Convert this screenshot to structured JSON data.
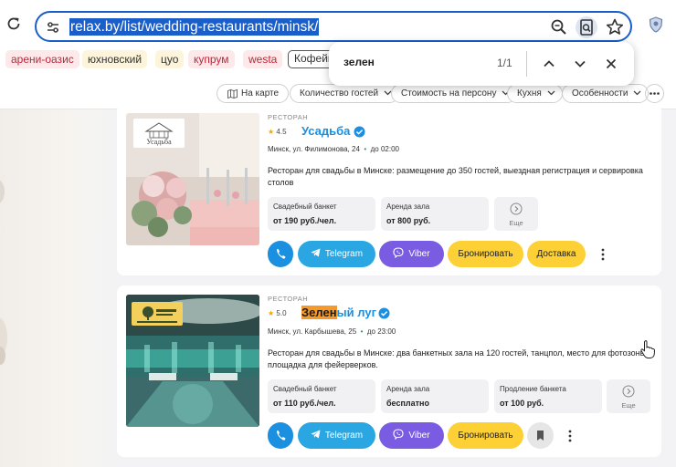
{
  "browser": {
    "url": "relax.by/list/wedding-restaurants/minsk/"
  },
  "tags": [
    {
      "label": "арени-оазис",
      "style": "red"
    },
    {
      "label": "юхновский",
      "style": "yellow"
    },
    {
      "label": "цуо",
      "style": "yellow"
    },
    {
      "label": "купрум",
      "style": "red"
    },
    {
      "label": "westa",
      "style": "red"
    },
    {
      "label": "Кофейн",
      "style": "outline"
    }
  ],
  "find": {
    "query": "зелен",
    "count": "1/1"
  },
  "filters": [
    {
      "label": "На карте"
    },
    {
      "label": "Количество гостей"
    },
    {
      "label": "Стоимость на персону"
    },
    {
      "label": "Кухня"
    },
    {
      "label": "Особенности"
    }
  ],
  "cards": [
    {
      "type": "РЕСТОРАН",
      "rating": "4.5",
      "name": "Усадьба",
      "address": "Минск, ул. Филимонова, 24",
      "hours": "до 02:00",
      "description": "Ресторан для свадьбы в Минске: размещение до 350 гостей, выездная регистрация и сервировка столов",
      "prices": [
        {
          "label": "Свадебный банкет",
          "value": "от 190 руб./чел."
        },
        {
          "label": "Аренда зала",
          "value": "от 800 руб."
        }
      ],
      "more_label": "Еще",
      "actions": {
        "telegram": "Telegram",
        "viber": "Viber",
        "book": "Бронировать",
        "delivery": "Доставка"
      },
      "logo_text": "Усадьба"
    },
    {
      "type": "РЕСТОРАН",
      "rating": "5.0",
      "name_highlight": "Зелен",
      "name_rest": "ый луг",
      "address": "Минск, ул. Карбышева, 25",
      "hours": "до 23:00",
      "description": "Ресторан для свадьбы в Минске: два банкетных зала на 120 гостей, танцпол, место для фотозоны, площадка для фейерверков.",
      "prices": [
        {
          "label": "Свадебный банкет",
          "value": "от 110 руб./чел."
        },
        {
          "label": "Аренда зала",
          "value": "бесплатно"
        },
        {
          "label": "Продление банкета",
          "value": "от 100 руб."
        }
      ],
      "more_label": "Еще",
      "actions": {
        "telegram": "Telegram",
        "viber": "Viber",
        "book": "Бронировать"
      }
    }
  ],
  "colors": {
    "accent": "#1a5ec9",
    "link": "#1b8fe0",
    "telegram": "#2aa7e3",
    "viber": "#7a5ce3",
    "book": "#fdd035",
    "highlight": "#f59a2a"
  }
}
